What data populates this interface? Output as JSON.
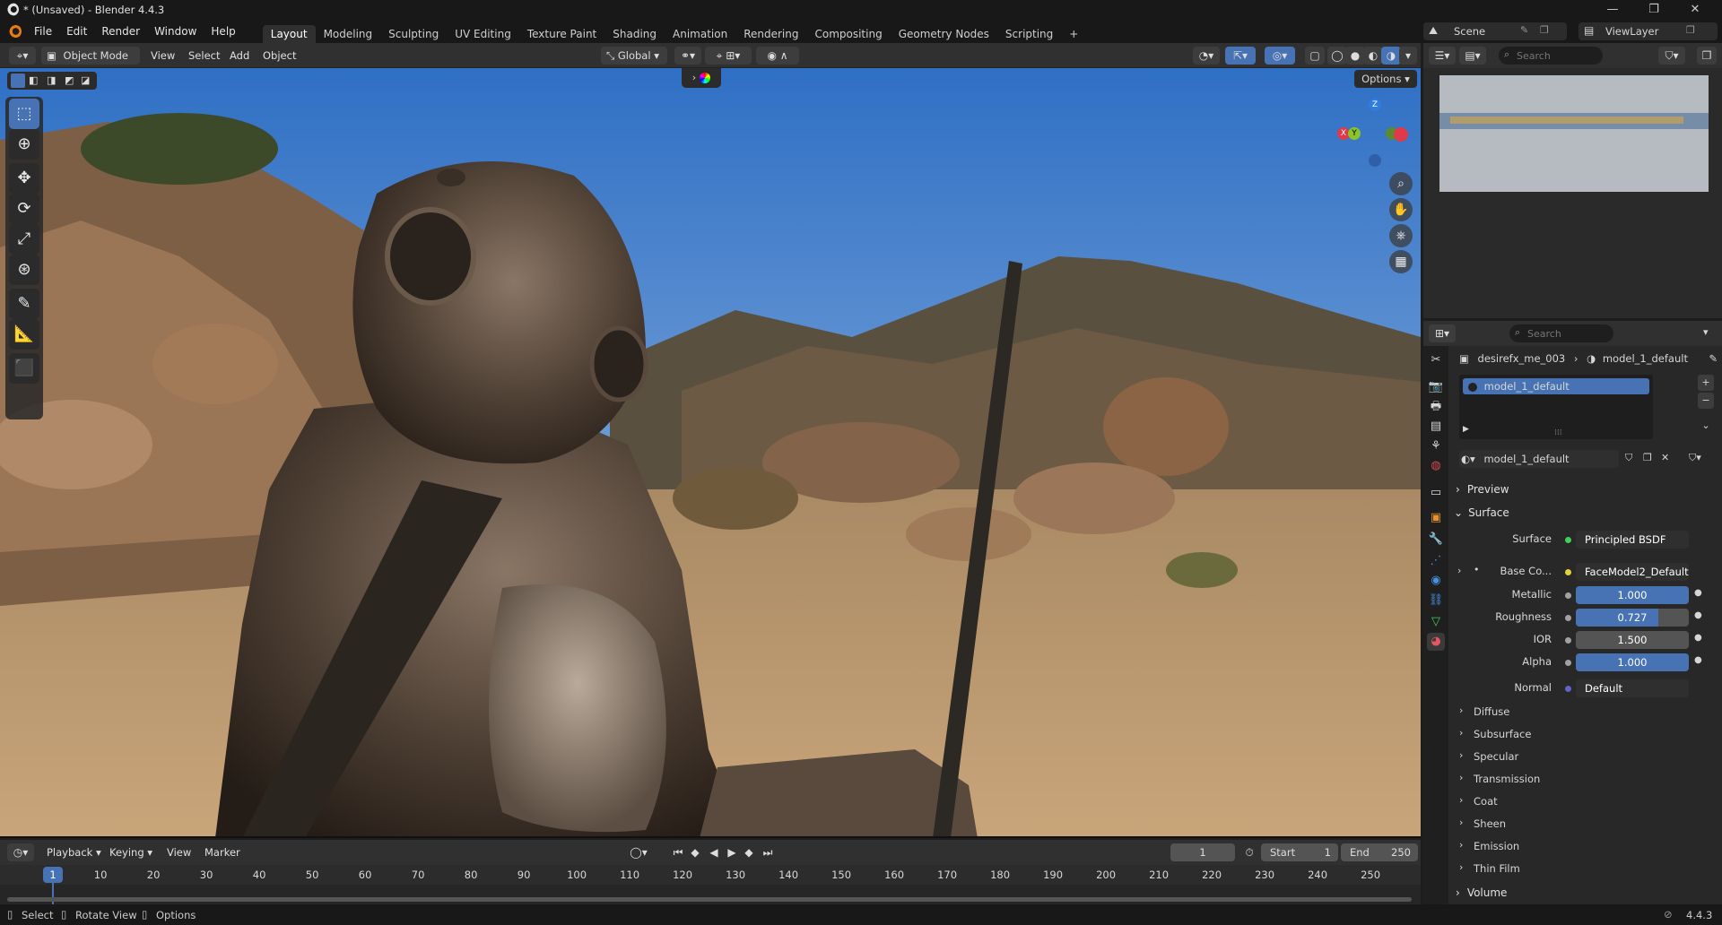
{
  "window": {
    "title": "* (Unsaved) - Blender 4.4.3",
    "controls": [
      "—",
      "❐",
      "✕"
    ]
  },
  "menu": [
    "File",
    "Edit",
    "Render",
    "Window",
    "Help"
  ],
  "workspaces": [
    "Layout",
    "Modeling",
    "Sculpting",
    "UV Editing",
    "Texture Paint",
    "Shading",
    "Animation",
    "Rendering",
    "Compositing",
    "Geometry Nodes",
    "Scripting"
  ],
  "active_workspace": "Layout",
  "scene_name": "Scene",
  "view_layer": "ViewLayer",
  "viewport_header": {
    "mode": "Object Mode",
    "menus": [
      "View",
      "Select",
      "Add",
      "Object"
    ],
    "transform_orientation": "Global",
    "options_label": "Options"
  },
  "outliner": {
    "search_placeholder": "Search"
  },
  "properties": {
    "search_placeholder": "Search",
    "breadcrumb": [
      "desirefx_me_003",
      "model_1_default"
    ],
    "material_slot": "model_1_default",
    "material_name": "model_1_default",
    "panels": {
      "preview": "Preview",
      "surface": "Surface",
      "volume": "Volume"
    },
    "surface_shader_label": "Surface",
    "surface_shader": "Principled BSDF",
    "base_color_label": "Base Co...",
    "base_color_value": "FaceModel2_Default...",
    "inputs": [
      {
        "label": "Metallic",
        "value": "1.000",
        "fraction": 1.0
      },
      {
        "label": "Roughness",
        "value": "0.727",
        "fraction": 0.727
      },
      {
        "label": "IOR",
        "value": "1.500",
        "fraction": 0
      },
      {
        "label": "Alpha",
        "value": "1.000",
        "fraction": 1.0
      }
    ],
    "normal_label": "Normal",
    "normal_value": "Default",
    "subpanels": [
      "Diffuse",
      "Subsurface",
      "Specular",
      "Transmission",
      "Coat",
      "Sheen",
      "Emission",
      "Thin Film"
    ]
  },
  "timeline": {
    "menus": [
      "Playback",
      "Keying",
      "View",
      "Marker"
    ],
    "current_frame": "1",
    "start_label": "Start",
    "start": "1",
    "end_label": "End",
    "end": "250",
    "ruler": [
      "10",
      "20",
      "30",
      "40",
      "50",
      "60",
      "70",
      "80",
      "90",
      "100",
      "110",
      "120",
      "130",
      "140",
      "150",
      "160",
      "170",
      "180",
      "190",
      "200",
      "210",
      "220",
      "230",
      "240",
      "250"
    ]
  },
  "status_bar": {
    "select": "Select",
    "rotate": "Rotate View",
    "options": "Options",
    "version": "4.4.3"
  },
  "colors": {
    "accent": "#4772b3",
    "header": "#303030",
    "panel": "#282828",
    "active_tab": "#e87d0d"
  }
}
